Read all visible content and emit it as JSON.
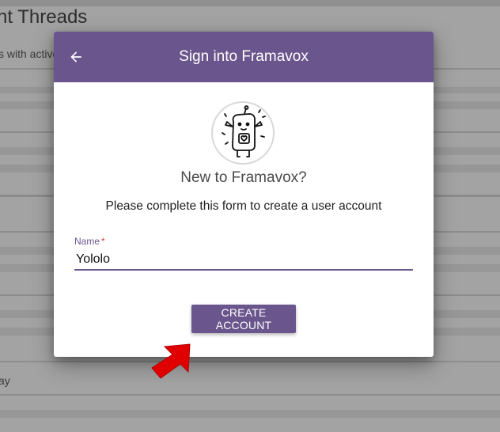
{
  "background": {
    "heading": "nt Threads",
    "subtext": "s with active",
    "footer_text": "ay"
  },
  "modal": {
    "title": "Sign into Framavox",
    "back_icon": "arrow-left-icon",
    "avatar_icon": "robot-mascot-icon",
    "welcome": "New to Framavox?",
    "instructions": "Please complete this form to create a user account",
    "name_field": {
      "label": "Name",
      "required_marker": "*",
      "value": "Yololo"
    },
    "create_button": "CREATE ACCOUNT"
  },
  "annotation": {
    "icon": "red-pointer-arrow-icon"
  },
  "colors": {
    "accent": "#6a568c",
    "required": "#e53935",
    "overlay_annotation": "#e00000"
  }
}
